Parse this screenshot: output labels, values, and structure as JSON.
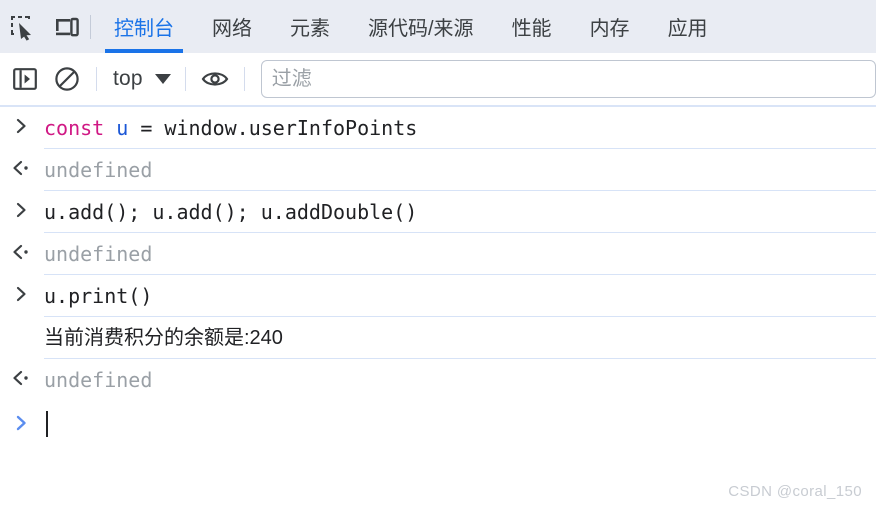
{
  "tabbar": {
    "inspect_icon": "inspect-element-icon",
    "device_icon": "device-toolbar-icon",
    "tabs": [
      {
        "label": "控制台",
        "active": true
      },
      {
        "label": "网络",
        "active": false
      },
      {
        "label": "元素",
        "active": false
      },
      {
        "label": "源代码/来源",
        "active": false
      },
      {
        "label": "性能",
        "active": false
      },
      {
        "label": "内存",
        "active": false
      },
      {
        "label": "应用",
        "active": false
      }
    ],
    "active_color": "#1a73e8",
    "background": "#e9ecf3"
  },
  "toolbar": {
    "sidebar_toggle_icon": "sidebar-toggle-icon",
    "clear_console_icon": "clear-console-icon",
    "context_label": "top",
    "dropdown_icon": "chevron-down-icon",
    "eye_icon": "live-expression-eye-icon",
    "filter_placeholder": "过滤",
    "filter_value": ""
  },
  "console": {
    "entries": [
      {
        "kind": "input",
        "marker": "input-arrow-icon",
        "segments": [
          {
            "text": "const",
            "style": "keyword"
          },
          {
            "text": " ",
            "style": "plain"
          },
          {
            "text": "u",
            "style": "var"
          },
          {
            "text": " = window.userInfoPoints",
            "style": "plain"
          }
        ],
        "text": "const u = window.userInfoPoints"
      },
      {
        "kind": "output",
        "marker": "output-arrow-icon",
        "text": "undefined"
      },
      {
        "kind": "input",
        "marker": "input-arrow-icon",
        "segments": [
          {
            "text": "u.add(); u.add(); u.addDouble()",
            "style": "plain"
          }
        ],
        "text": "u.add(); u.add(); u.addDouble()"
      },
      {
        "kind": "output",
        "marker": "output-arrow-icon",
        "text": "undefined"
      },
      {
        "kind": "input",
        "marker": "input-arrow-icon",
        "segments": [
          {
            "text": "u.print()",
            "style": "plain"
          }
        ],
        "text": "u.print()"
      },
      {
        "kind": "logmsg",
        "marker": "",
        "text": "当前消费积分的余额是:240"
      },
      {
        "kind": "output",
        "marker": "output-arrow-icon",
        "text": "undefined"
      }
    ],
    "prompt": {
      "marker": "prompt-arrow-icon",
      "value": "",
      "marker_color": "#5b8def"
    }
  },
  "watermark": {
    "text": "CSDN @coral_150"
  }
}
